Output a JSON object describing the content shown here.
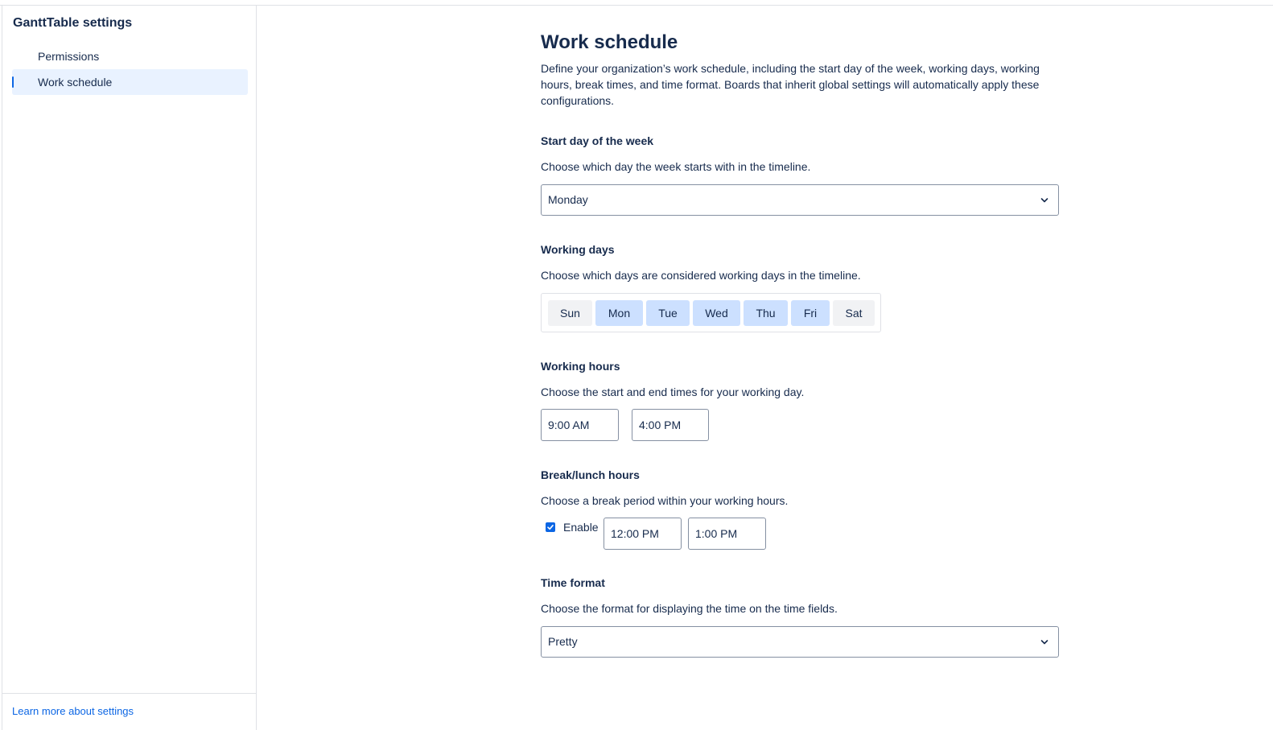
{
  "sidebar": {
    "title": "GanttTable settings",
    "items": [
      {
        "label": "Permissions",
        "active": false
      },
      {
        "label": "Work schedule",
        "active": true
      }
    ],
    "footer_link": "Learn more about settings"
  },
  "main": {
    "title": "Work schedule",
    "description": "Define your organization’s work schedule, including the start day of the week, working days, working hours, break times, and time format. Boards that inherit global settings will automatically apply these configurations.",
    "start_day": {
      "title": "Start day of the week",
      "help": "Choose which day the week starts with in the timeline.",
      "value": "Monday"
    },
    "working_days": {
      "title": "Working days",
      "help": "Choose which days are considered working days in the timeline.",
      "days": [
        {
          "label": "Sun",
          "selected": false
        },
        {
          "label": "Mon",
          "selected": true
        },
        {
          "label": "Tue",
          "selected": true
        },
        {
          "label": "Wed",
          "selected": true
        },
        {
          "label": "Thu",
          "selected": true
        },
        {
          "label": "Fri",
          "selected": true
        },
        {
          "label": "Sat",
          "selected": false
        }
      ]
    },
    "working_hours": {
      "title": "Working hours",
      "help": "Choose the start and end times for your working day.",
      "start": "9:00 AM",
      "end": "4:00 PM"
    },
    "break_hours": {
      "title": "Break/lunch hours",
      "help": "Choose a break period within your working hours.",
      "enable_label": "Enable",
      "enabled": true,
      "start": "12:00 PM",
      "end": "1:00 PM"
    },
    "time_format": {
      "title": "Time format",
      "help": "Choose the format for displaying the time on the time fields.",
      "value": "Pretty"
    }
  },
  "colors": {
    "accent": "#0c66e4",
    "selected_day": "#cce0ff",
    "unselected_day": "#f1f2f4",
    "active_nav": "#e9f2ff"
  }
}
